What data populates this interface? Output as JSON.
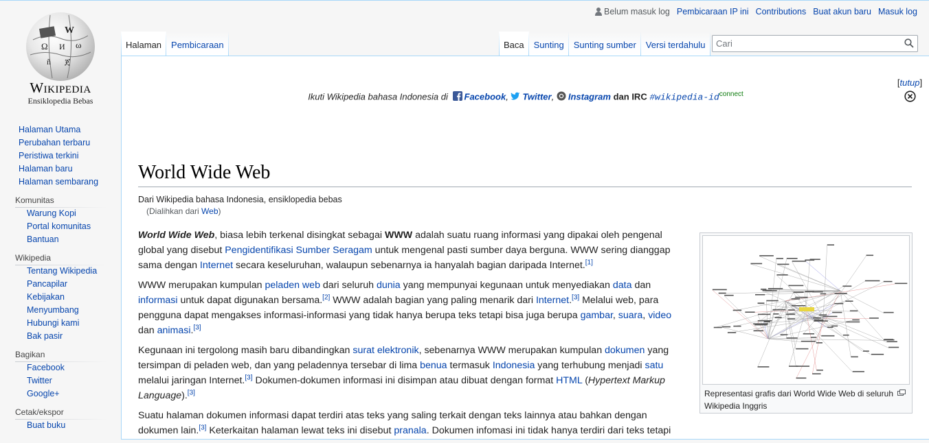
{
  "logo": {
    "wordmark": "Wikipedia",
    "tagline": "Ensiklopedia Bebas"
  },
  "personal": {
    "not_logged_in": "Belum masuk log",
    "ip_talk": "Pembicaraan IP ini",
    "contributions": "Contributions",
    "create_account": "Buat akun baru",
    "login": "Masuk log"
  },
  "tabs": {
    "left": [
      "Halaman",
      "Pembicaraan"
    ],
    "right": [
      "Baca",
      "Sunting",
      "Sunting sumber",
      "Versi terdahulu"
    ]
  },
  "search": {
    "placeholder": "Cari"
  },
  "sidebar": {
    "navigation": [
      "Halaman Utama",
      "Perubahan terbaru",
      "Peristiwa terkini",
      "Halaman baru",
      "Halaman sembarang"
    ],
    "community": {
      "title": "Komunitas",
      "items": [
        "Warung Kopi",
        "Portal komunitas",
        "Bantuan"
      ]
    },
    "wikipedia": {
      "title": "Wikipedia",
      "items": [
        "Tentang Wikipedia",
        "Pancapilar",
        "Kebijakan",
        "Menyumbang",
        "Hubungi kami",
        "Bak pasir"
      ]
    },
    "share": {
      "title": "Bagikan",
      "items": [
        "Facebook",
        "Twitter",
        "Google+"
      ]
    },
    "print": {
      "title": "Cetak/ekspor",
      "items": [
        "Buat buku"
      ]
    }
  },
  "notice": {
    "prefix": "Ikuti Wikipedia bahasa Indonesia di",
    "facebook": "Facebook",
    "comma1": ",",
    "twitter": "Twitter",
    "comma2": ",",
    "instagram": "Instagram",
    "and": "dan IRC",
    "irc": "#wikipedia-id",
    "connect": "connect",
    "dismiss": "tutup"
  },
  "article": {
    "title": "World Wide Web",
    "site_sub": "Dari Wikipedia bahasa Indonesia, ensiklopedia bebas",
    "redirect_prefix": "(Dialihkan dari ",
    "redirect_link": "Web",
    "redirect_suffix": ")"
  },
  "p1": {
    "t0": "World Wide Web",
    "t1": ", biasa lebih terkenal disingkat sebagai ",
    "t2": "WWW",
    "t3": " adalah suatu ruang informasi yang dipakai oleh pengenal global yang disebut ",
    "l1": "Pengidentifikasi Sumber Seragam",
    "t4": " untuk mengenal pasti sumber daya berguna. WWW sering dianggap sama dengan ",
    "l2": "Internet",
    "t5": " secara keseluruhan, walaupun sebenarnya ia hanyalah bagian daripada Internet.",
    "r1": "[1]"
  },
  "p2": {
    "t0": "WWW merupakan kumpulan ",
    "l1": "peladen web",
    "t1": " dari seluruh ",
    "l2": "dunia",
    "t2": " yang mempunyai kegunaan untuk menyediakan ",
    "l3": "data",
    "t3": " dan ",
    "l4": "informasi",
    "t4": " untuk dapat digunakan bersama.",
    "r1": "[2]",
    "t5": " WWW adalah bagian yang paling menarik dari ",
    "l5": "Internet",
    "t6": ".",
    "r2": "[3]",
    "t7": " Melalui web, para pengguna dapat mengakses informasi-informasi yang tidak hanya berupa teks tetapi bisa juga berupa ",
    "l6": "gambar",
    "t8": ", ",
    "l7": "suara",
    "t9": ", ",
    "l8": "video",
    "t10": " dan ",
    "l9": "animasi",
    "t11": ".",
    "r3": "[3]"
  },
  "p3": {
    "t0": "Kegunaan ini tergolong masih baru dibandingkan ",
    "l1": "surat elektronik",
    "t1": ", sebenarnya WWW merupakan kumpulan ",
    "l2": "dokumen",
    "t2": " yang tersimpan di peladen web, dan yang peladennya tersebar di lima ",
    "l3": "benua",
    "t3": " termasuk ",
    "l4": "Indonesia",
    "t4": " yang terhubung menjadi ",
    "l5": "satu",
    "t5": " melalui jaringan Internet.",
    "r1": "[3]",
    "t6": " Dokumen-dokumen informasi ini disimpan atau dibuat dengan format ",
    "l6": "HTML",
    "t7": " (",
    "i1": "Hypertext Markup Language",
    "t8": ").",
    "r2": "[3]"
  },
  "p4": {
    "t0": "Suatu halaman dokumen informasi dapat terdiri atas teks yang saling terkait dengan teks lainnya atau bahkan dengan dokumen lain.",
    "r1": "[3]",
    "t1": " Keterkaitan halaman lewat teks ini disebut ",
    "l1": "pranala",
    "t2": ". Dokumen infomasi ini tidak hanya terdiri dari teks tetapi"
  },
  "thumb": {
    "caption": "Representasi grafis dari World Wide Web di seluruh Wikipedia Inggris"
  },
  "colors": {
    "link": "#0645ad",
    "border": "#a7d7f9",
    "background": "#f6f6f6"
  }
}
